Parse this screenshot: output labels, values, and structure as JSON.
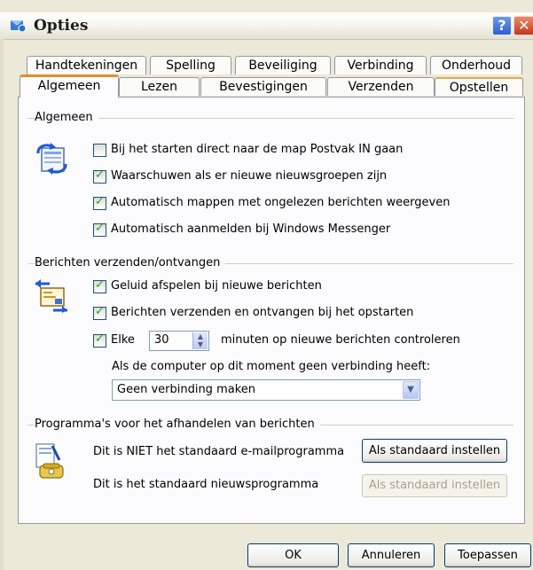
{
  "window": {
    "title": "Opties"
  },
  "tabs_row1": [
    {
      "label": "Handtekeningen"
    },
    {
      "label": "Spelling"
    },
    {
      "label": "Beveiliging"
    },
    {
      "label": "Verbinding"
    },
    {
      "label": "Onderhoud"
    }
  ],
  "tabs_row2": [
    {
      "label": "Algemeen",
      "selected": true
    },
    {
      "label": "Lezen"
    },
    {
      "label": "Bevestigingen"
    },
    {
      "label": "Verzenden"
    },
    {
      "label": "Opstellen"
    }
  ],
  "general": {
    "title": "Algemeen",
    "options": [
      {
        "label": "Bij het starten direct naar de map Postvak IN gaan",
        "checked": false
      },
      {
        "label": "Waarschuwen als er nieuwe nieuwsgroepen zijn",
        "checked": true
      },
      {
        "label": "Automatisch mappen met ongelezen berichten weergeven",
        "checked": true
      },
      {
        "label": "Automatisch aanmelden bij Windows Messenger",
        "checked": true
      }
    ]
  },
  "sendreceive": {
    "title": "Berichten verzenden/ontvangen",
    "options": [
      {
        "label": "Geluid afspelen bij nieuwe berichten",
        "checked": true
      },
      {
        "label": "Berichten verzenden en ontvangen bij het opstarten",
        "checked": true
      }
    ],
    "every": {
      "label": "Elke",
      "checked": true,
      "value": "30",
      "suffix": "minuten op nieuwe berichten controleren"
    },
    "offline_label": "Als de computer op dit moment geen verbinding heeft:",
    "offline_value": "Geen verbinding maken"
  },
  "programs": {
    "title": "Programma's voor het afhandelen van berichten",
    "mail_text": "Dit is NIET het standaard e-mailprogramma",
    "mail_button": "Als standaard instellen",
    "news_text": "Dit is het standaard nieuwsprogramma",
    "news_button": "Als standaard instellen"
  },
  "footer": {
    "ok": "OK",
    "cancel": "Annuleren",
    "apply": "Toepassen"
  },
  "colors": {
    "title_text": "#1c1c1c",
    "tab_highlight": "#e68b2c",
    "check": "#21a121",
    "dialog_bg": "#ece9d8"
  }
}
